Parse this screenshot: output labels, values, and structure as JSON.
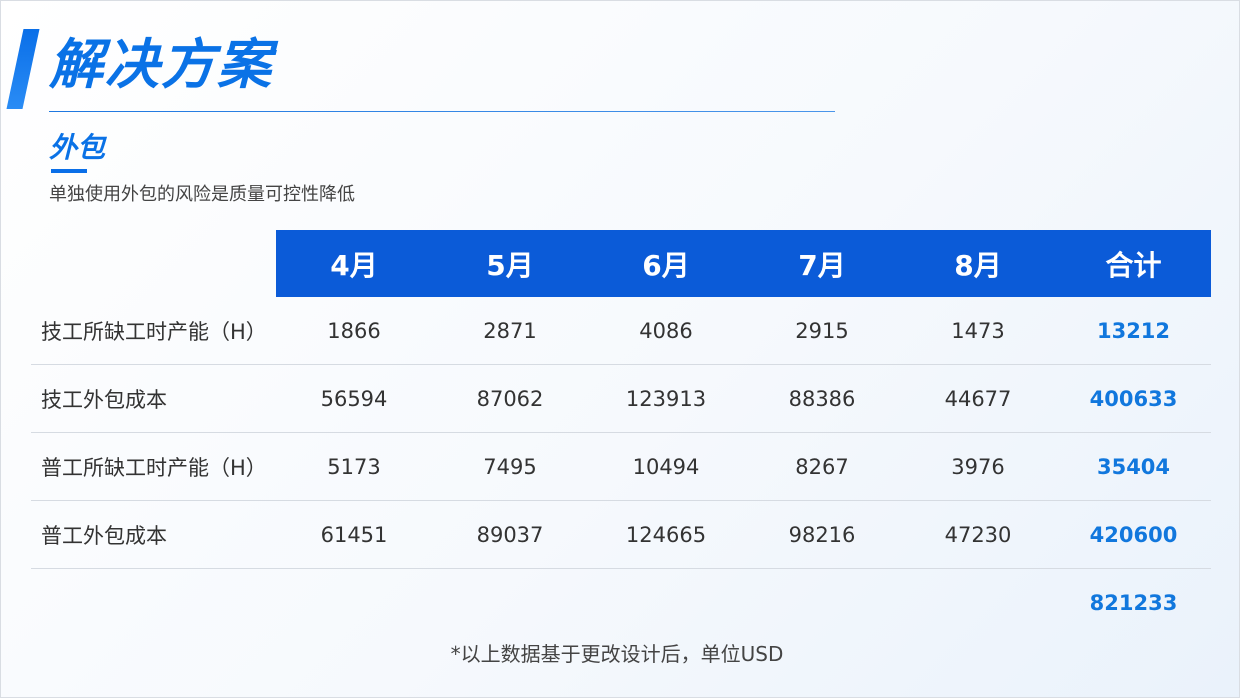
{
  "header": {
    "title": "解决方案",
    "subtitle": "外包",
    "description": "单独使用外包的风险是质量可控性降低"
  },
  "table": {
    "columns": [
      "4月",
      "5月",
      "6月",
      "7月",
      "8月",
      "合计"
    ],
    "rows": [
      {
        "label": "技工所缺工时产能（H）",
        "values": [
          "1866",
          "2871",
          "4086",
          "2915",
          "1473"
        ],
        "total": "13212"
      },
      {
        "label": "技工外包成本",
        "values": [
          "56594",
          "87062",
          "123913",
          "88386",
          "44677"
        ],
        "total": "400633"
      },
      {
        "label": "普工所缺工时产能（H）",
        "values": [
          "5173",
          "7495",
          "10494",
          "8267",
          "3976"
        ],
        "total": "35404"
      },
      {
        "label": "普工外包成本",
        "values": [
          "61451",
          "89037",
          "124665",
          "98216",
          "47230"
        ],
        "total": "420600"
      }
    ],
    "grand_total": "821233"
  },
  "footnote": "*以上数据基于更改设计后，单位USD",
  "colors": {
    "accent": "#0a72e6",
    "header_bg": "#0b5bd8",
    "total_text": "#1177dd"
  }
}
